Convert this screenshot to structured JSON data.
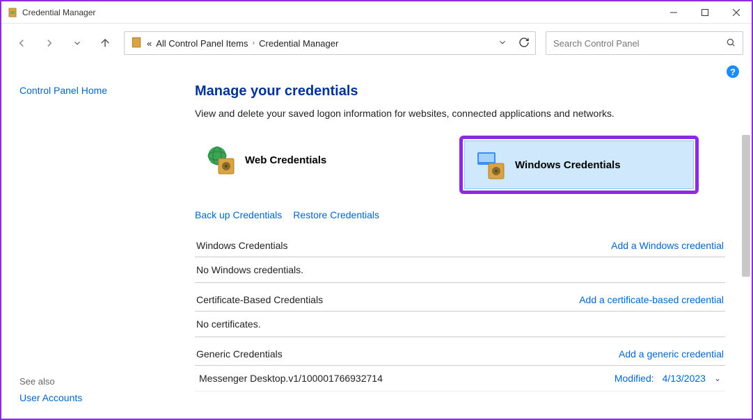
{
  "window": {
    "title": "Credential Manager"
  },
  "breadcrumb": {
    "prefix": "«",
    "item1": "All Control Panel Items",
    "item2": "Credential Manager"
  },
  "search": {
    "placeholder": "Search Control Panel"
  },
  "sidebar": {
    "home": "Control Panel Home",
    "see_also_label": "See also",
    "user_accounts": "User Accounts"
  },
  "main": {
    "title": "Manage your credentials",
    "desc": "View and delete your saved logon information for websites, connected applications and networks.",
    "tiles": {
      "web": "Web Credentials",
      "windows": "Windows Credentials"
    },
    "actions": {
      "backup": "Back up Credentials",
      "restore": "Restore Credentials"
    },
    "sections": {
      "windows": {
        "name": "Windows Credentials",
        "add": "Add a Windows credential",
        "empty": "No Windows credentials."
      },
      "cert": {
        "name": "Certificate-Based Credentials",
        "add": "Add a certificate-based credential",
        "empty": "No certificates."
      },
      "generic": {
        "name": "Generic Credentials",
        "add": "Add a generic credential",
        "rows": [
          {
            "name": "Messenger Desktop.v1/100001766932714",
            "modified_label": "Modified:",
            "modified_date": "4/13/2023"
          }
        ]
      }
    }
  }
}
